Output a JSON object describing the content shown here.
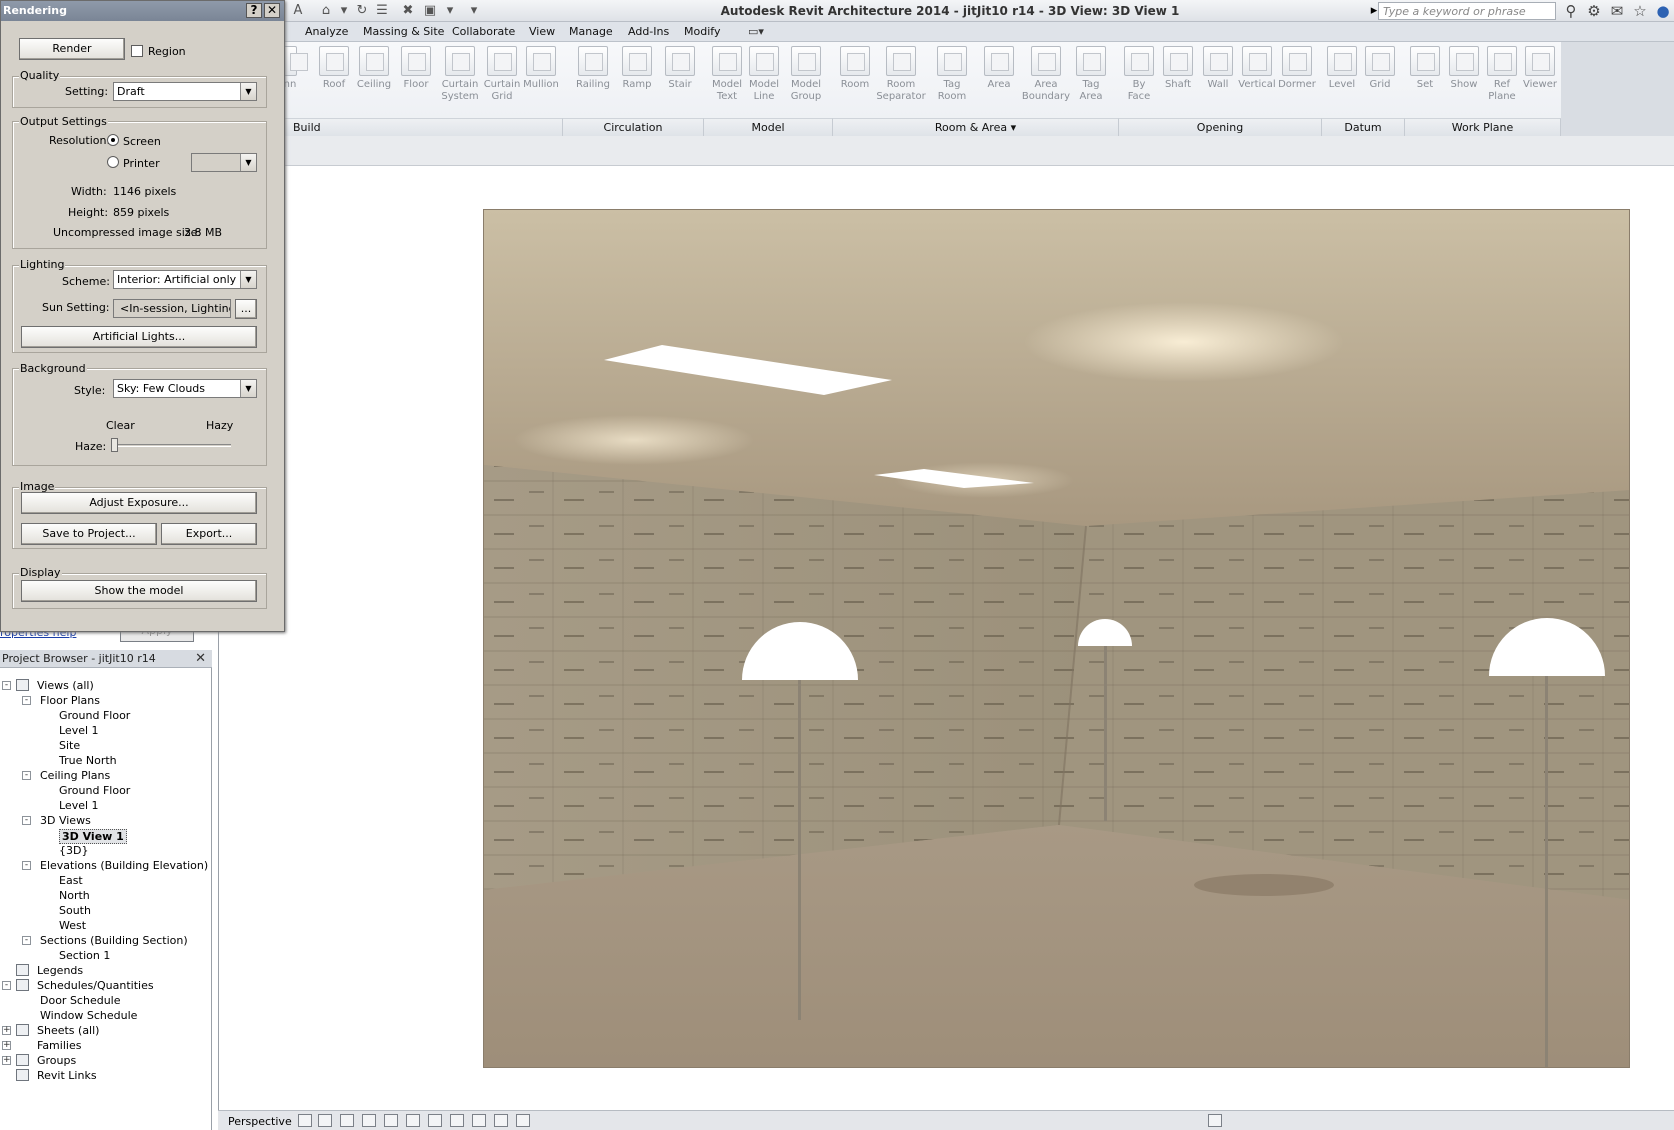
{
  "app": {
    "title": "Autodesk Revit Architecture 2014 -    jitJit10 r14 - 3D View: 3D View 1",
    "search_placeholder": "Type a keyword or phrase"
  },
  "menu": {
    "tabs": [
      "Analyze",
      "Massing & Site",
      "Collaborate",
      "View",
      "Manage",
      "Add-Ins",
      "Modify"
    ]
  },
  "ribbon": {
    "buttons": [
      {
        "label": "nn"
      },
      {
        "label": "Roof"
      },
      {
        "label": "Ceiling"
      },
      {
        "label": "Floor"
      },
      {
        "label": "Curtain\nSystem"
      },
      {
        "label": "Curtain\nGrid"
      },
      {
        "label": "Mullion"
      },
      {
        "label": "Railing"
      },
      {
        "label": "Ramp"
      },
      {
        "label": "Stair"
      },
      {
        "label": "Model\nText"
      },
      {
        "label": "Model\nLine"
      },
      {
        "label": "Model\nGroup"
      },
      {
        "label": "Room"
      },
      {
        "label": "Room\nSeparator"
      },
      {
        "label": "Tag\nRoom"
      },
      {
        "label": "Area"
      },
      {
        "label": "Area\nBoundary"
      },
      {
        "label": "Tag\nArea"
      },
      {
        "label": "By\nFace"
      },
      {
        "label": "Shaft"
      },
      {
        "label": "Wall"
      },
      {
        "label": "Vertical"
      },
      {
        "label": "Dormer"
      },
      {
        "label": "Level"
      },
      {
        "label": "Grid"
      },
      {
        "label": "Set"
      },
      {
        "label": "Show"
      },
      {
        "label": "Ref\nPlane"
      },
      {
        "label": "Viewer"
      }
    ],
    "panels": [
      "Build",
      "Circulation",
      "Model",
      "Room & Area",
      "Opening",
      "Datum",
      "Work Plane"
    ]
  },
  "dialog": {
    "title": "Rendering",
    "render_label": "Render",
    "region_label": "Region",
    "quality": {
      "group": "Quality",
      "setting_label": "Setting:",
      "setting_value": "Draft"
    },
    "output": {
      "group": "Output Settings",
      "resolution_label": "Resolution:",
      "screen_label": "Screen",
      "printer_label": "Printer",
      "width_label": "Width:",
      "width_value": "1146 pixels",
      "height_label": "Height:",
      "height_value": "859 pixels",
      "size_label": "Uncompressed image size:",
      "size_value": "3.8 MB"
    },
    "lighting": {
      "group": "Lighting",
      "scheme_label": "Scheme:",
      "scheme_value": "Interior: Artificial only",
      "sun_label": "Sun Setting:",
      "sun_value": "<In-session, Lighting>",
      "sun_more": "...",
      "artificial_label": "Artificial Lights..."
    },
    "background": {
      "group": "Background",
      "style_label": "Style:",
      "style_value": "Sky: Few Clouds",
      "clear_label": "Clear",
      "hazy_label": "Hazy",
      "haze_label": "Haze:",
      "haze_level": 0
    },
    "image": {
      "group": "Image",
      "exposure_label": "Adjust Exposure...",
      "save_label": "Save to Project...",
      "export_label": "Export..."
    },
    "display": {
      "group": "Display",
      "show_label": "Show the model"
    }
  },
  "properties": {
    "help_link": "roperties help",
    "apply_label": "Apply"
  },
  "browser": {
    "title": "Project Browser - jitJit10 r14",
    "nodes": [
      {
        "label": "Views (all)",
        "level": 0,
        "toggle": "-",
        "icon": true
      },
      {
        "label": "Floor Plans",
        "level": 1,
        "toggle": "-"
      },
      {
        "label": "Ground Floor",
        "level": 2
      },
      {
        "label": "Level 1",
        "level": 2
      },
      {
        "label": "Site",
        "level": 2
      },
      {
        "label": "True North",
        "level": 2
      },
      {
        "label": "Ceiling Plans",
        "level": 1,
        "toggle": "-"
      },
      {
        "label": "Ground Floor",
        "level": 2
      },
      {
        "label": "Level 1",
        "level": 2
      },
      {
        "label": "3D Views",
        "level": 1,
        "toggle": "-"
      },
      {
        "label": "3D View 1",
        "level": 2,
        "selected": true
      },
      {
        "label": "{3D}",
        "level": 2
      },
      {
        "label": "Elevations (Building Elevation)",
        "level": 1,
        "toggle": "-"
      },
      {
        "label": "East",
        "level": 2
      },
      {
        "label": "North",
        "level": 2
      },
      {
        "label": "South",
        "level": 2
      },
      {
        "label": "West",
        "level": 2
      },
      {
        "label": "Sections (Building Section)",
        "level": 1,
        "toggle": "-"
      },
      {
        "label": "Section 1",
        "level": 2
      },
      {
        "label": "Legends",
        "level": 0,
        "icon": true
      },
      {
        "label": "Schedules/Quantities",
        "level": 0,
        "toggle": "-",
        "icon": true
      },
      {
        "label": "Door Schedule",
        "level": 1
      },
      {
        "label": "Window Schedule",
        "level": 1
      },
      {
        "label": "Sheets (all)",
        "level": 0,
        "toggle": "+",
        "icon": true
      },
      {
        "label": "Families",
        "level": 0,
        "toggle": "+"
      },
      {
        "label": "Groups",
        "level": 0,
        "toggle": "+",
        "icon": true
      },
      {
        "label": "Revit Links",
        "level": 0,
        "icon": true
      }
    ]
  },
  "statusbar": {
    "view_mode": "Perspective"
  },
  "colors": {
    "render_wall": "#a39882",
    "render_ceiling": "#b9ab93",
    "render_floor": "#a39480",
    "lamp_shade": "#ffffff"
  }
}
